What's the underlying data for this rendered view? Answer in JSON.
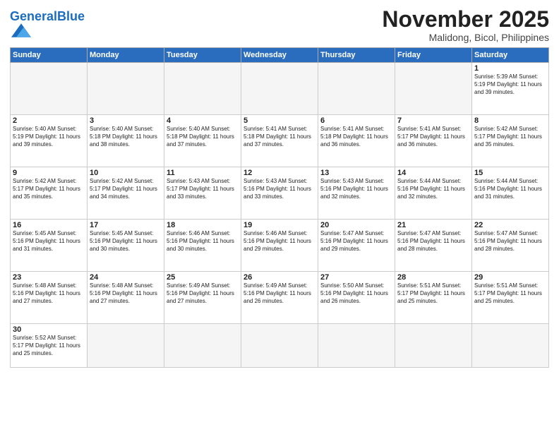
{
  "header": {
    "logo_general": "General",
    "logo_blue": "Blue",
    "month_title": "November 2025",
    "location": "Malidong, Bicol, Philippines"
  },
  "weekdays": [
    "Sunday",
    "Monday",
    "Tuesday",
    "Wednesday",
    "Thursday",
    "Friday",
    "Saturday"
  ],
  "weeks": [
    [
      {
        "day": "",
        "info": ""
      },
      {
        "day": "",
        "info": ""
      },
      {
        "day": "",
        "info": ""
      },
      {
        "day": "",
        "info": ""
      },
      {
        "day": "",
        "info": ""
      },
      {
        "day": "",
        "info": ""
      },
      {
        "day": "1",
        "info": "Sunrise: 5:39 AM\nSunset: 5:19 PM\nDaylight: 11 hours\nand 39 minutes."
      }
    ],
    [
      {
        "day": "2",
        "info": "Sunrise: 5:40 AM\nSunset: 5:19 PM\nDaylight: 11 hours\nand 39 minutes."
      },
      {
        "day": "3",
        "info": "Sunrise: 5:40 AM\nSunset: 5:18 PM\nDaylight: 11 hours\nand 38 minutes."
      },
      {
        "day": "4",
        "info": "Sunrise: 5:40 AM\nSunset: 5:18 PM\nDaylight: 11 hours\nand 37 minutes."
      },
      {
        "day": "5",
        "info": "Sunrise: 5:41 AM\nSunset: 5:18 PM\nDaylight: 11 hours\nand 37 minutes."
      },
      {
        "day": "6",
        "info": "Sunrise: 5:41 AM\nSunset: 5:18 PM\nDaylight: 11 hours\nand 36 minutes."
      },
      {
        "day": "7",
        "info": "Sunrise: 5:41 AM\nSunset: 5:17 PM\nDaylight: 11 hours\nand 36 minutes."
      },
      {
        "day": "8",
        "info": "Sunrise: 5:42 AM\nSunset: 5:17 PM\nDaylight: 11 hours\nand 35 minutes."
      }
    ],
    [
      {
        "day": "9",
        "info": "Sunrise: 5:42 AM\nSunset: 5:17 PM\nDaylight: 11 hours\nand 35 minutes."
      },
      {
        "day": "10",
        "info": "Sunrise: 5:42 AM\nSunset: 5:17 PM\nDaylight: 11 hours\nand 34 minutes."
      },
      {
        "day": "11",
        "info": "Sunrise: 5:43 AM\nSunset: 5:17 PM\nDaylight: 11 hours\nand 33 minutes."
      },
      {
        "day": "12",
        "info": "Sunrise: 5:43 AM\nSunset: 5:16 PM\nDaylight: 11 hours\nand 33 minutes."
      },
      {
        "day": "13",
        "info": "Sunrise: 5:43 AM\nSunset: 5:16 PM\nDaylight: 11 hours\nand 32 minutes."
      },
      {
        "day": "14",
        "info": "Sunrise: 5:44 AM\nSunset: 5:16 PM\nDaylight: 11 hours\nand 32 minutes."
      },
      {
        "day": "15",
        "info": "Sunrise: 5:44 AM\nSunset: 5:16 PM\nDaylight: 11 hours\nand 31 minutes."
      }
    ],
    [
      {
        "day": "16",
        "info": "Sunrise: 5:45 AM\nSunset: 5:16 PM\nDaylight: 11 hours\nand 31 minutes."
      },
      {
        "day": "17",
        "info": "Sunrise: 5:45 AM\nSunset: 5:16 PM\nDaylight: 11 hours\nand 30 minutes."
      },
      {
        "day": "18",
        "info": "Sunrise: 5:46 AM\nSunset: 5:16 PM\nDaylight: 11 hours\nand 30 minutes."
      },
      {
        "day": "19",
        "info": "Sunrise: 5:46 AM\nSunset: 5:16 PM\nDaylight: 11 hours\nand 29 minutes."
      },
      {
        "day": "20",
        "info": "Sunrise: 5:47 AM\nSunset: 5:16 PM\nDaylight: 11 hours\nand 29 minutes."
      },
      {
        "day": "21",
        "info": "Sunrise: 5:47 AM\nSunset: 5:16 PM\nDaylight: 11 hours\nand 28 minutes."
      },
      {
        "day": "22",
        "info": "Sunrise: 5:47 AM\nSunset: 5:16 PM\nDaylight: 11 hours\nand 28 minutes."
      }
    ],
    [
      {
        "day": "23",
        "info": "Sunrise: 5:48 AM\nSunset: 5:16 PM\nDaylight: 11 hours\nand 27 minutes."
      },
      {
        "day": "24",
        "info": "Sunrise: 5:48 AM\nSunset: 5:16 PM\nDaylight: 11 hours\nand 27 minutes."
      },
      {
        "day": "25",
        "info": "Sunrise: 5:49 AM\nSunset: 5:16 PM\nDaylight: 11 hours\nand 27 minutes."
      },
      {
        "day": "26",
        "info": "Sunrise: 5:49 AM\nSunset: 5:16 PM\nDaylight: 11 hours\nand 26 minutes."
      },
      {
        "day": "27",
        "info": "Sunrise: 5:50 AM\nSunset: 5:16 PM\nDaylight: 11 hours\nand 26 minutes."
      },
      {
        "day": "28",
        "info": "Sunrise: 5:51 AM\nSunset: 5:17 PM\nDaylight: 11 hours\nand 25 minutes."
      },
      {
        "day": "29",
        "info": "Sunrise: 5:51 AM\nSunset: 5:17 PM\nDaylight: 11 hours\nand 25 minutes."
      }
    ],
    [
      {
        "day": "30",
        "info": "Sunrise: 5:52 AM\nSunset: 5:17 PM\nDaylight: 11 hours\nand 25 minutes."
      },
      {
        "day": "",
        "info": ""
      },
      {
        "day": "",
        "info": ""
      },
      {
        "day": "",
        "info": ""
      },
      {
        "day": "",
        "info": ""
      },
      {
        "day": "",
        "info": ""
      },
      {
        "day": "",
        "info": ""
      }
    ]
  ]
}
